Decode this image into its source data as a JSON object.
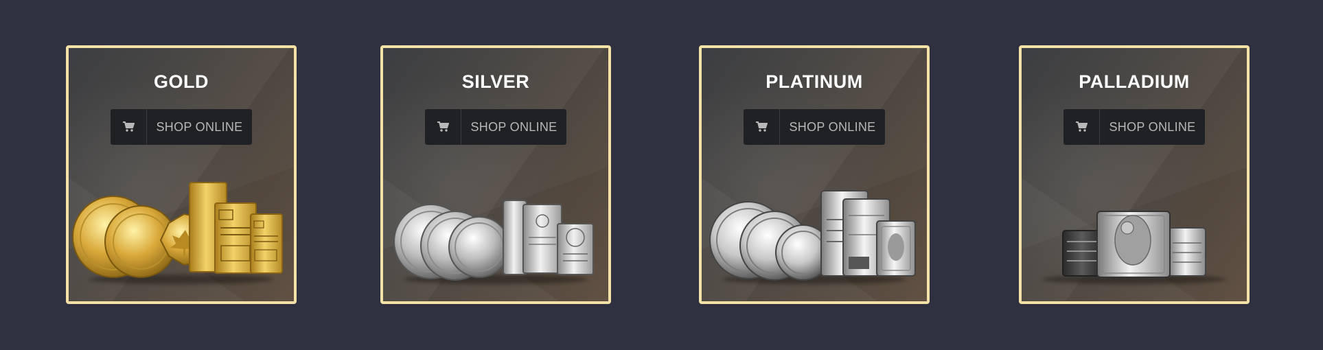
{
  "cards": [
    {
      "title": "GOLD",
      "button_label": "SHOP ONLINE",
      "button_icon": "shopping-cart-icon"
    },
    {
      "title": "SILVER",
      "button_label": "SHOP ONLINE",
      "button_icon": "shopping-cart-icon"
    },
    {
      "title": "PLATINUM",
      "button_label": "SHOP ONLINE",
      "button_icon": "shopping-cart-icon"
    },
    {
      "title": "PALLADIUM",
      "button_label": "SHOP ONLINE",
      "button_icon": "shopping-cart-icon"
    }
  ],
  "colors": {
    "page_background": "#2f3140",
    "card_border": "#f6e2a6",
    "button_background": "#202124",
    "button_text": "#b8b8b8",
    "title_text": "#ffffff"
  }
}
